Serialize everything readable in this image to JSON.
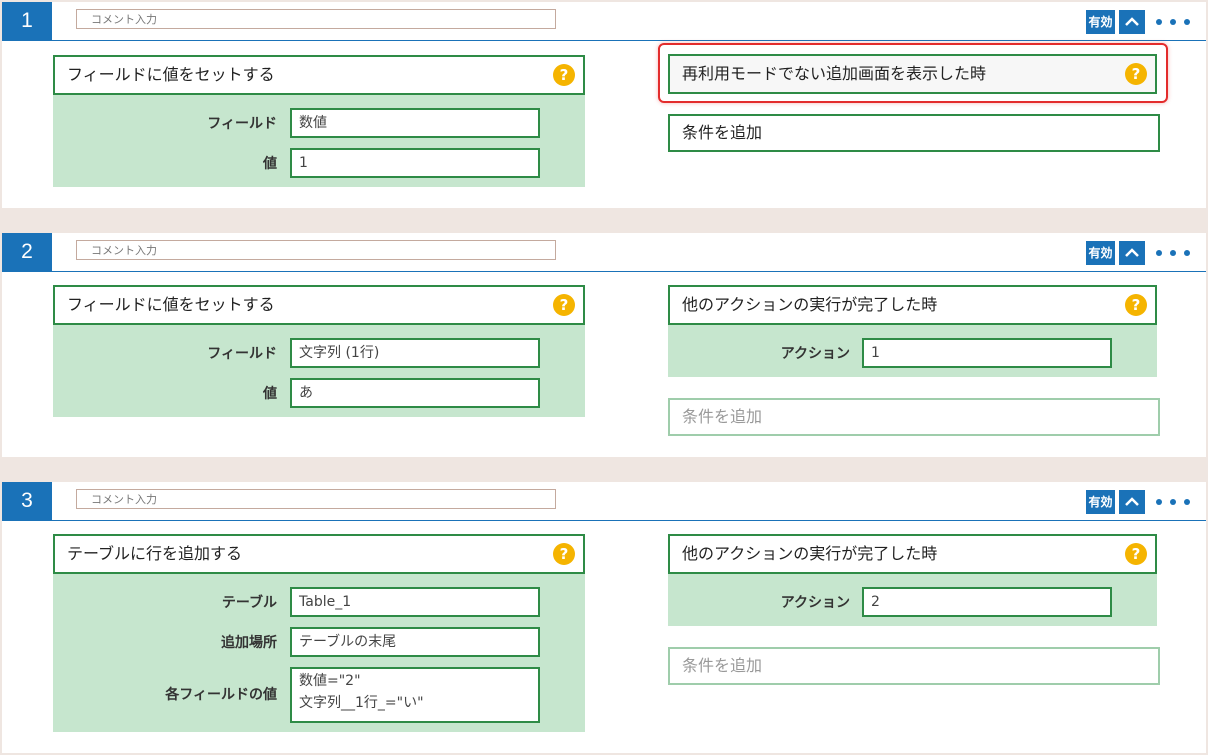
{
  "rules": [
    {
      "number": "1",
      "comment_placeholder": "コメント入力",
      "enabled_label": "有効",
      "action": {
        "title": "フィールドに値をセットする",
        "fields": [
          {
            "label": "フィールド",
            "value": "数値"
          },
          {
            "label": "値",
            "value": "1"
          }
        ]
      },
      "trigger": {
        "title": "再利用モードでない追加画面を表示した時",
        "highlighted": true
      },
      "add_condition_label": "条件を追加"
    },
    {
      "number": "2",
      "comment_placeholder": "コメント入力",
      "enabled_label": "有効",
      "action": {
        "title": "フィールドに値をセットする",
        "fields": [
          {
            "label": "フィールド",
            "value": "文字列 (1行)"
          },
          {
            "label": "値",
            "value": "あ"
          }
        ]
      },
      "trigger": {
        "title": "他のアクションの実行が完了した時",
        "fields": [
          {
            "label": "アクション",
            "value": "1"
          }
        ]
      },
      "add_condition_label": "条件を追加"
    },
    {
      "number": "3",
      "comment_placeholder": "コメント入力",
      "enabled_label": "有効",
      "action": {
        "title": "テーブルに行を追加する",
        "fields": [
          {
            "label": "テーブル",
            "value": "Table_1"
          },
          {
            "label": "追加場所",
            "value": "テーブルの末尾"
          },
          {
            "label": "各フィールドの値",
            "value_lines": [
              "数値=\"2\"",
              "文字列__1行_=\"い\""
            ]
          }
        ]
      },
      "trigger": {
        "title": "他のアクションの実行が完了した時",
        "fields": [
          {
            "label": "アクション",
            "value": "2"
          }
        ]
      },
      "add_condition_label": "条件を追加"
    }
  ],
  "icons": {
    "help": "question-circle-icon",
    "collapse": "chevron-up-icon",
    "more": "more-horizontal-icon"
  },
  "colors": {
    "accent_blue": "#1a72b8",
    "green_border": "#2e8b46",
    "green_fill": "#c6e6ce",
    "help_yellow": "#f5b400",
    "highlight_red": "#e32c2c"
  }
}
